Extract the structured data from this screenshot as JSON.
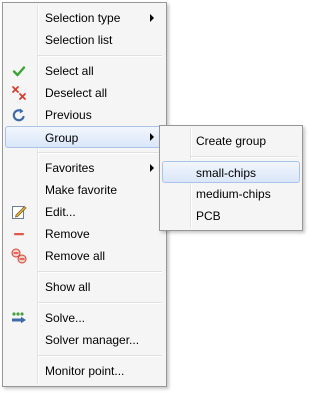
{
  "main_menu": {
    "selection_type": "Selection type",
    "selection_list": "Selection list",
    "select_all": "Select all",
    "deselect_all": "Deselect all",
    "previous": "Previous",
    "group": "Group",
    "favorites": "Favorites",
    "make_favorite": "Make favorite",
    "edit": "Edit...",
    "remove": "Remove",
    "remove_all": "Remove all",
    "show_all": "Show all",
    "solve": "Solve...",
    "solver_manager": "Solver manager...",
    "monitor_point": "Monitor point..."
  },
  "group_submenu": {
    "create_group": "Create group",
    "groups": [
      "small-chips",
      "medium-chips",
      "PCB"
    ]
  },
  "colors": {
    "check_green": "#3aa535",
    "cross_red": "#d8402f",
    "minus_red": "#e4564a",
    "highlight_border": "#a9c3ea"
  }
}
